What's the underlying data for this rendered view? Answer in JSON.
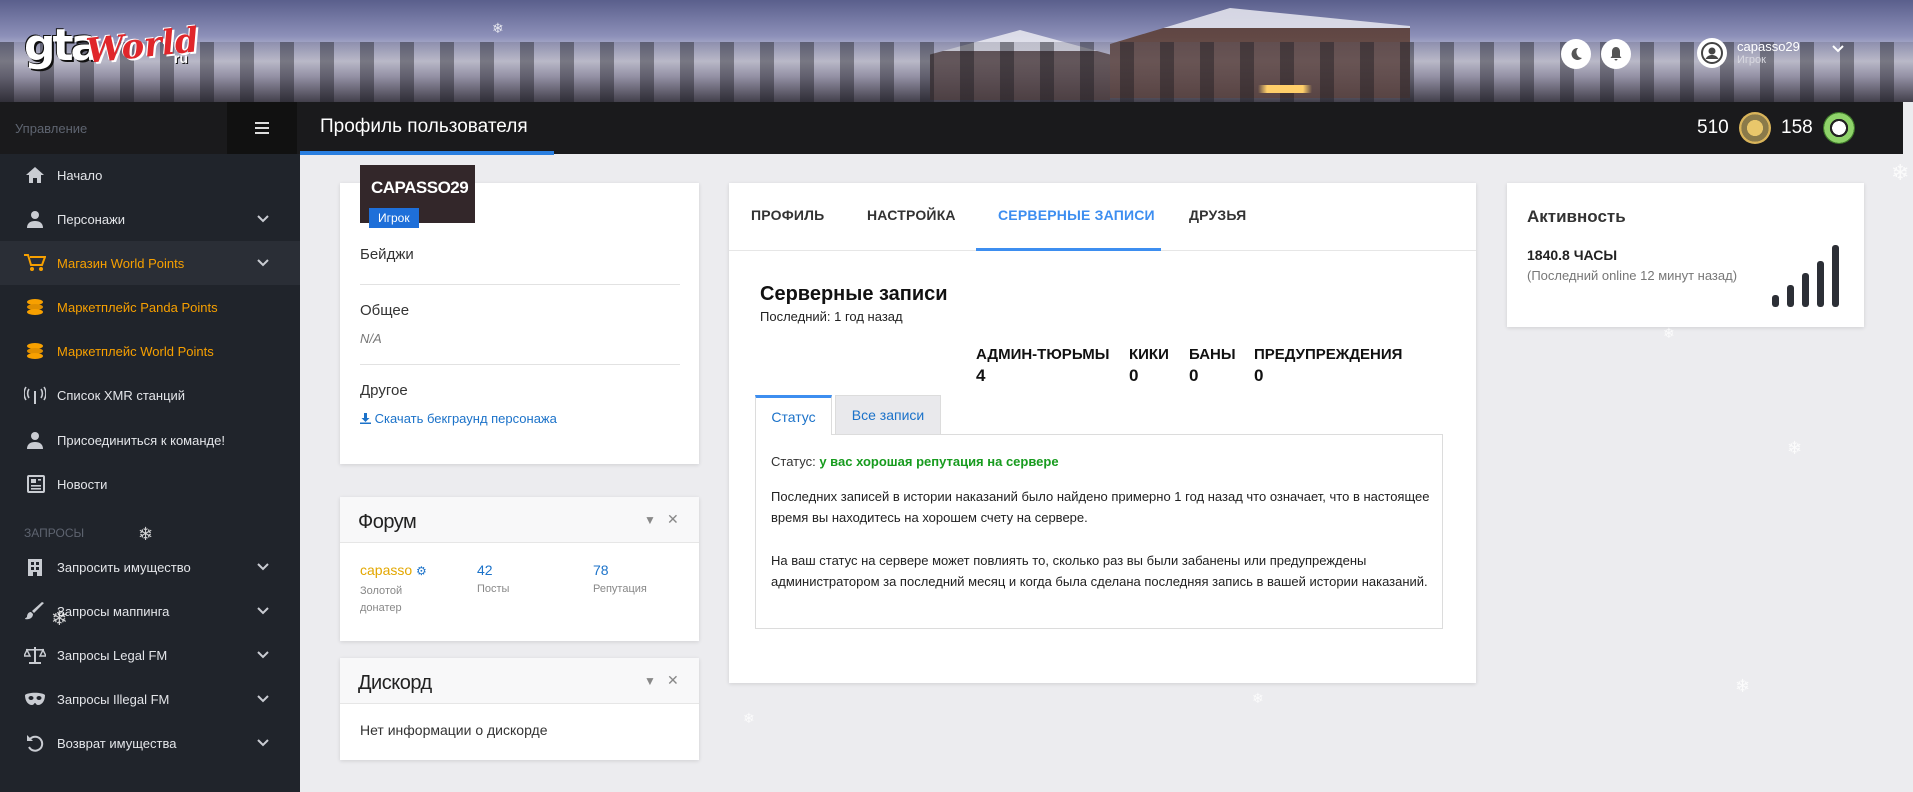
{
  "brand": {
    "logo_gta": "gta",
    "logo_world": "World",
    "logo_ru": "ru"
  },
  "header": {
    "user_name": "capasso29",
    "user_role": "Игрок",
    "page_title": "Профиль пользователя",
    "world_points": "510",
    "panda_points": "158"
  },
  "sidebar": {
    "manage_label": "Управление",
    "requests_label": "ЗАПРОСЫ",
    "items": [
      {
        "label": "Начало",
        "icon": "home-icon"
      },
      {
        "label": "Персонажи",
        "icon": "person-icon"
      },
      {
        "label": "Магазин World Points",
        "icon": "cart-icon"
      },
      {
        "label": "Маркетплейс Panda Points",
        "icon": "coins-icon"
      },
      {
        "label": "Маркетплейс World Points",
        "icon": "coins-icon"
      },
      {
        "label": "Список XMR станций",
        "icon": "antenna-icon"
      },
      {
        "label": "Присоединиться к команде!",
        "icon": "person-icon"
      },
      {
        "label": "Новости",
        "icon": "newspaper-icon"
      },
      {
        "label": "Запросить имущество",
        "icon": "building-icon"
      },
      {
        "label": "Запросы маппинга",
        "icon": "brush-icon"
      },
      {
        "label": "Запросы Legal FM",
        "icon": "scales-icon"
      },
      {
        "label": "Запросы Illegal FM",
        "icon": "mask-icon"
      },
      {
        "label": "Возврат имущества",
        "icon": "undo-icon"
      }
    ]
  },
  "profile": {
    "name": "CAPASSO29",
    "role": "Игрок",
    "badges_label": "Бейджи",
    "general_label": "Общее",
    "general_value": "N/A",
    "other_label": "Другое",
    "download_link": "Скачать бекграунд персонажа"
  },
  "forum": {
    "title": "Форум",
    "user": "capasso",
    "rank": "Золотой донатер",
    "posts_value": "42",
    "posts_label": "Посты",
    "rep_value": "78",
    "rep_label": "Репутация"
  },
  "discord": {
    "title": "Дискорд",
    "text": "Нет информации о дискорде"
  },
  "tabs": {
    "profile": "ПРОФИЛЬ",
    "settings": "НАСТРОЙКА",
    "server_records": "СЕРВЕРНЫЕ ЗАПИСИ",
    "friends": "ДРУЗЬЯ"
  },
  "records": {
    "title": "Серверные записи",
    "last": "Последний: 1 год назад",
    "stats": [
      {
        "label": "АДМИН-ТЮРЬМЫ",
        "value": "4"
      },
      {
        "label": "КИКИ",
        "value": "0"
      },
      {
        "label": "БАНЫ",
        "value": "0"
      },
      {
        "label": "ПРЕДУПРЕЖДЕНИЯ",
        "value": "0"
      }
    ],
    "subtab_status": "Статус",
    "subtab_all": "Все записи",
    "status_prefix": "Статус:",
    "status_value": "у вас хорошая репутация на сервере",
    "para1": "Последних записей в истории наказаний было найдено примерно 1 год назад что означает, что в настоящее время вы находитесь на хорошем счету на сервере.",
    "para2": "На ваш статус на сервере может повлиять то, сколько раз вы были забанены или предупреждены администратором за последний месяц и когда была сделана последняя запись в вашей истории наказаний."
  },
  "activity": {
    "title": "Активность",
    "hours": "1840.8 ЧАСЫ",
    "last_online": "(Последний online 12 минут назад)",
    "signal_level": 5
  },
  "colors": {
    "accent": "#3d8ef0",
    "orange": "#f7a000",
    "sidebar": "#20242b",
    "good": "#179b1e"
  }
}
